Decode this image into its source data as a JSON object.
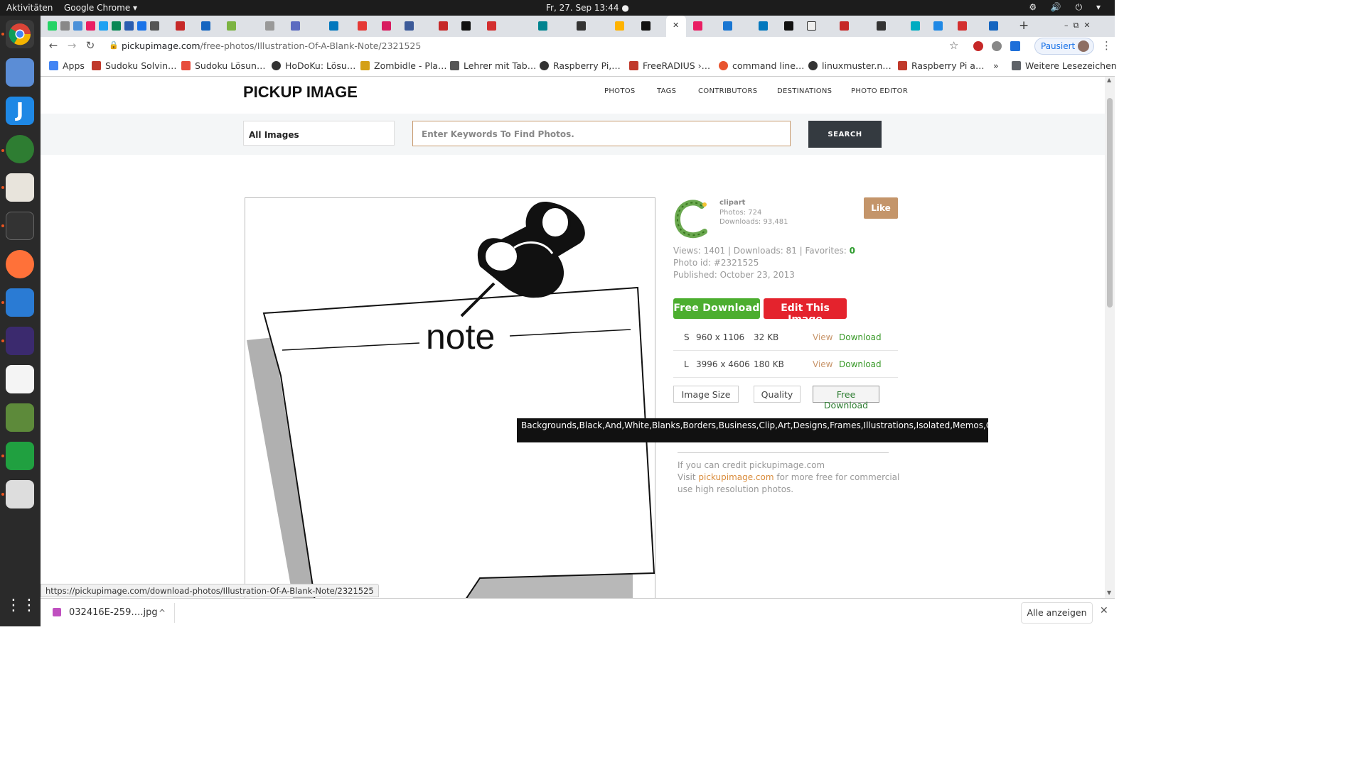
{
  "desktop": {
    "activities": "Aktivitäten",
    "app_name": "Google Chrome ▾",
    "clock": "Fr, 27. Sep  13:44 ●",
    "system_icons": "⚙ 🔊 ⏻ ▾"
  },
  "browser": {
    "url_host": "pickupimage.com",
    "url_path": "/free-photos/Illustration-Of-A-Blank-Note/2321525",
    "paused_label": "Pausiert",
    "new_tab": "+",
    "tab_close": "✕",
    "window_controls": "–  ⧉  ✕",
    "bookmarks": [
      {
        "label": "Apps",
        "color": "#4285f4"
      },
      {
        "label": "Sudoku Solvin…",
        "color": "#c0392b"
      },
      {
        "label": "Sudoku Lösun…",
        "color": "#e74c3c"
      },
      {
        "label": "HoDoKu: Lösu…",
        "color": "#333333"
      },
      {
        "label": "Zombidle - Pla…",
        "color": "#d4a017"
      },
      {
        "label": "Lehrer mit Tab…",
        "color": "#555555"
      },
      {
        "label": "Raspberry Pi,…",
        "color": "#333333"
      },
      {
        "label": "FreeRADIUS ›…",
        "color": "#c0392b"
      },
      {
        "label": "command line…",
        "color": "#e8542f"
      },
      {
        "label": "linuxmuster.n…",
        "color": "#333333"
      },
      {
        "label": "Raspberry Pi a…",
        "color": "#c0392b"
      }
    ],
    "bookmarks_more": "»",
    "other_bookmarks": "Weitere Lesezeichen"
  },
  "site": {
    "logo": "PICKUP IMAGE",
    "nav": [
      "PHOTOS",
      "TAGS",
      "CONTRIBUTORS",
      "DESTINATIONS",
      "PHOTO EDITOR"
    ],
    "category_select": "All Images",
    "search_placeholder": "Enter Keywords To Find Photos.",
    "search_button": "SEARCH"
  },
  "image": {
    "note_word": "note"
  },
  "author": {
    "name": "clipart",
    "photos": "Photos: 724",
    "downloads": "Downloads: 93,481",
    "like": "Like"
  },
  "stats": {
    "views_line": "Views: 1401 | Downloads: 81 | Favorites: ",
    "favorites": "0",
    "photo_id": "Photo id: #2321525",
    "published": "Published: October 23, 2013"
  },
  "actions": {
    "free_download": "Free Download",
    "edit": "Edit This Image"
  },
  "sizes": [
    {
      "code": "S",
      "dims": "960 x 1106",
      "filesize": "32 KB",
      "view": "View",
      "download": "Download"
    },
    {
      "code": "L",
      "dims": "3996 x 4606",
      "filesize": "180 KB",
      "view": "View",
      "download": "Download"
    }
  ],
  "options": {
    "image_size": "Image Size",
    "quality": "Quality",
    "free_download": "Free Download"
  },
  "tooltip": "Backgrounds,Black,And,White,Blanks,Borders,Business,Clip,Art,Designs,Frames,Illustrations,Isolated,Memos,Office,Papers,Push,Pins,Transparent,Background",
  "credit": {
    "line1": "If you can credit pickupimage.com",
    "visit": "Visit ",
    "link": "pickupimage.com",
    "line2_rest": " for more free for commercial",
    "line3": "use high resolution photos."
  },
  "status_url": "https://pickupimage.com/download-photos/Illustration-Of-A-Blank-Note/2321525",
  "download_bar": {
    "filename": "032416E-259….jpg",
    "chevron": "^",
    "show_all": "Alle anzeigen",
    "close": "✕"
  }
}
